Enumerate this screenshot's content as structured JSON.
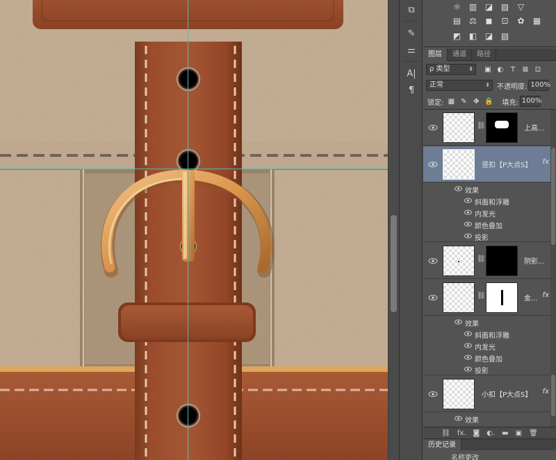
{
  "colors": {
    "canvas_fabric": "#c7b198",
    "leather": "#96492a",
    "leather_dark": "#6e3119",
    "buckle": "#e0a05a",
    "guide_line": "#56b7b4",
    "panel_bg": "#535353",
    "selected_layer": "#6c7d95"
  },
  "tool_icons": [
    "history-brush-icon",
    "brush-preset-icon",
    "adjust-sliders-icon",
    "character-icon",
    "paragraph-icon"
  ],
  "tool_glyphs": [
    "⧉",
    "✎",
    "⚌",
    "A|",
    "¶"
  ],
  "adjustments": {
    "row1": [
      "☼",
      "▥",
      "◪",
      "▨",
      "▽"
    ],
    "row2": [
      "▤",
      "⚖",
      "◼",
      "⊡",
      "✿",
      "▦"
    ],
    "row3": [
      "◩",
      "◧",
      "◪",
      "▧"
    ]
  },
  "layers_panel": {
    "tabs": [
      "图层",
      "通道",
      "路径"
    ],
    "filter_kind": "ρ 类型",
    "filter_glyphs": [
      "▣",
      "◐",
      "T",
      "⊠",
      "⊡"
    ],
    "blend_mode": "正常",
    "opacity_label": "不透明度:",
    "opacity_value": "100%",
    "lock_label": "锁定:",
    "lock_glyphs": [
      "▦",
      "✎",
      "✥",
      "🔒"
    ],
    "fill_label": "填充:",
    "fill_value": "100%",
    "fx_label": "fx",
    "chain_glyph": "⛓",
    "effects_label": "效果",
    "layers": [
      {
        "name": "上高...",
        "has_fx": false,
        "selected": false
      },
      {
        "name": "竖扣【P大点S】",
        "has_fx": true,
        "selected": true
      },
      {
        "name": "阴影...",
        "has_fx": false,
        "selected": false
      },
      {
        "name": "金...",
        "has_fx": true,
        "selected": false
      },
      {
        "name": "小扣【P大点S】",
        "has_fx": true,
        "selected": false
      }
    ],
    "effects_set_a": [
      "斜面和浮雕",
      "内发光",
      "颜色叠加",
      "投影"
    ],
    "effects_set_b": [
      "斜面和浮雕",
      "内发光",
      "颜色叠加",
      "投影"
    ],
    "footer_icons": [
      "⛓",
      "fx.",
      "◙",
      "◐.",
      "▬",
      "▣",
      "🗑"
    ]
  },
  "history_panel": {
    "tab": "历史记录",
    "partial_item": "名称更改"
  }
}
